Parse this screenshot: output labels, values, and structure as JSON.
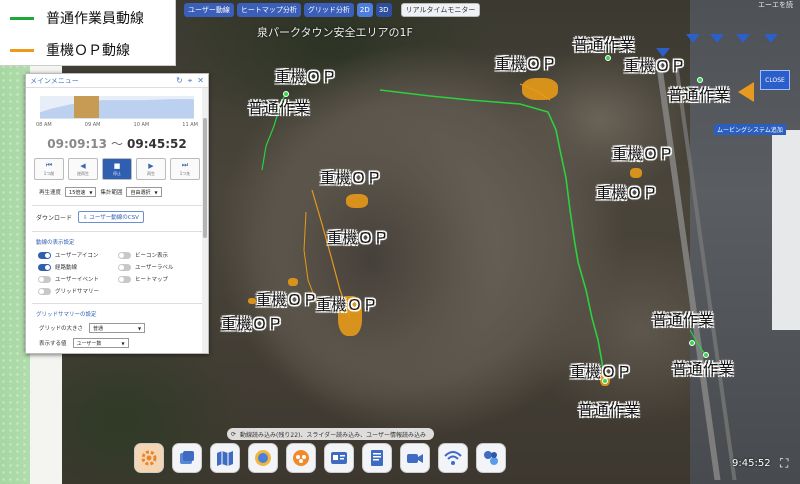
{
  "legend": {
    "items": [
      {
        "label": "普通作業員動線",
        "color": "#1fa83a"
      },
      {
        "label": "重機ＯＰ動線",
        "color": "#f19a1a"
      }
    ]
  },
  "toolbar": {
    "user_btn": "ユーザー動線",
    "heatmap_btn": "ヒートマップ分析",
    "grid_btn": "グリッド分析",
    "mode_2d": "2D",
    "mode_3d": "3D",
    "realtime_btn": "リアルタイムモニター"
  },
  "top_right_text": "エーエを読",
  "map": {
    "title": "泉パークタウン安全エリアの1F",
    "labels": [
      "重機ＯＰ",
      "普通作業",
      "重機ＯＰ",
      "普通作業",
      "重機ＯＰ",
      "普通作業",
      "重機ＯＰ",
      "重機ＯＰ",
      "重機ＯＰ",
      "重機ＯＰ",
      "重機ＯＰ",
      "重機ＯＰ",
      "重機ＯＰ",
      "普通作業",
      "普通作業",
      "重機ＯＰ",
      "普通作業"
    ],
    "close_label": "CLOSE",
    "info_tag": "ムービングシステム追加"
  },
  "menu": {
    "title": "メインメニュー",
    "timeline_labels": [
      "08 AM",
      "09 AM",
      "10 AM",
      "11 AM"
    ],
    "time_start": "09:09:13",
    "time_sep": "〜",
    "time_end": "09:45:52",
    "playback": [
      {
        "icon": "⏮",
        "label": "1つ前"
      },
      {
        "icon": "◀",
        "label": "逆再生"
      },
      {
        "icon": "■",
        "label": "停止"
      },
      {
        "icon": "▶",
        "label": "再生"
      },
      {
        "icon": "⏭",
        "label": "1つ先"
      }
    ],
    "speed_label": "再生速度",
    "speed_value": "15倍速",
    "range_label": "集計範囲",
    "range_value": "自由選択",
    "download_label": "ダウンロード",
    "csv_label": "ユーザー動線のCSV",
    "display_section": "動線の表示設定",
    "toggles": [
      {
        "label": "ユーザーアイコン",
        "on": true
      },
      {
        "label": "ビーコン表示",
        "on": false
      },
      {
        "label": "経路動線",
        "on": true
      },
      {
        "label": "ユーザーラベル",
        "on": false
      },
      {
        "label": "ユーザーイベント",
        "on": false
      },
      {
        "label": "ヒートマップ",
        "on": false
      },
      {
        "label": "グリッドサマリー",
        "on": false
      }
    ],
    "grid_section": "グリッドサマリーの設定",
    "grid_size_label": "グリッドの大きさ",
    "grid_size_value": "普通",
    "display_target_label": "表示する値",
    "display_target_value": "ユーザー数"
  },
  "status_bar": "動線読み込み(残り22)、スライダー読み込み、ユーザー情報読み込み",
  "clock": "9:45:52"
}
